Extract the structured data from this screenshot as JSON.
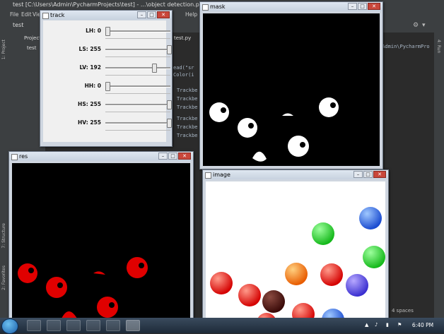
{
  "pycharm": {
    "title": "test [C:\\Users\\Admin\\PycharmProjects\\test] - ...\\object detection.py [test] - PyCharm",
    "menu": [
      "File",
      "Edit",
      "View",
      "Help"
    ],
    "project_label": "Project",
    "project_root": "test",
    "tab_file": "test.py",
    "editor_lines": [
      "ead(\"sr",
      "Color(i",
      "Trackbe",
      "Trackbe",
      "Trackbe",
      "Trackbe",
      "Trackbe",
      "Trackbe",
      "Trackbe"
    ],
    "path_text": "\\Admin\\PycharmPro",
    "side_labels": [
      "1: Project",
      "7: Structure",
      "2: Favorites",
      "4: Run"
    ],
    "status_text": "4 spaces"
  },
  "track_window": {
    "title": "track",
    "sliders": [
      {
        "label": "LH: 0",
        "value": 0,
        "max": 179
      },
      {
        "label": "LS: 255",
        "value": 255,
        "max": 255
      },
      {
        "label": "LV: 192",
        "value": 192,
        "max": 255
      },
      {
        "label": "HH: 0",
        "value": 0,
        "max": 179
      },
      {
        "label": "HS: 255",
        "value": 255,
        "max": 255
      },
      {
        "label": "HV: 255",
        "value": 255,
        "max": 255
      }
    ]
  },
  "mask_window": {
    "title": "mask"
  },
  "res_window": {
    "title": "res"
  },
  "image_window": {
    "title": "image"
  },
  "taskbar": {
    "time": "6:40 PM"
  },
  "colors": {
    "red_blob": "#e00000",
    "mask_blob": "#ffffff",
    "bg_black": "#000000"
  }
}
